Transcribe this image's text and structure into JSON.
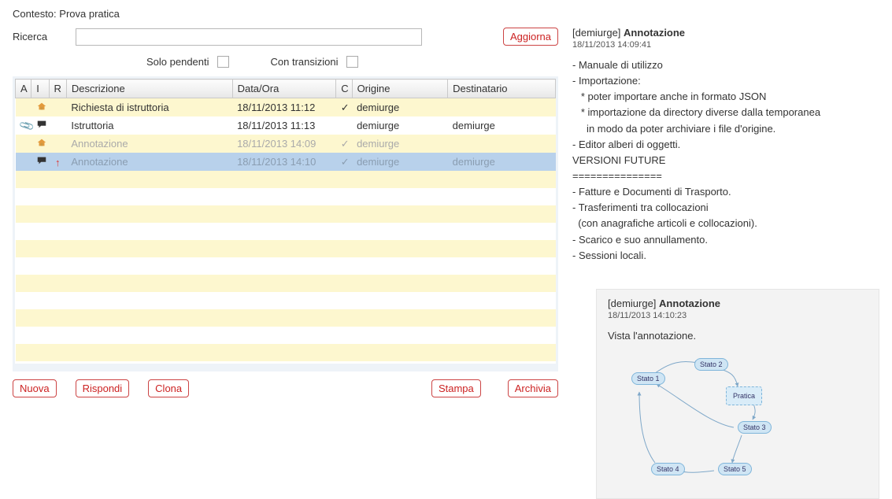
{
  "context": {
    "label": "Contesto:",
    "value": "Prova pratica"
  },
  "search": {
    "label": "Ricerca",
    "value": ""
  },
  "buttons": {
    "aggiorna": "Aggiorna",
    "nuova": "Nuova",
    "rispondi": "Rispondi",
    "clona": "Clona",
    "stampa": "Stampa",
    "archivia": "Archivia"
  },
  "filters": {
    "solo_pendenti": "Solo pendenti",
    "con_transizioni": "Con transizioni"
  },
  "columns": {
    "a": "A",
    "i": "I",
    "r": "R",
    "descrizione": "Descrizione",
    "data_ora": "Data/Ora",
    "c": "C",
    "origine": "Origine",
    "destinatario": "Destinatario"
  },
  "rows": [
    {
      "i_icon": "home",
      "desc": "Richiesta di istruttoria",
      "dt": "18/11/2013 11:12",
      "c": "✓",
      "orig": "demiurge",
      "dest": "",
      "stripe": true
    },
    {
      "a_icon": "clip",
      "i_icon": "chat",
      "desc": "Istruttoria",
      "dt": "18/11/2013 11:13",
      "c": "",
      "orig": "demiurge",
      "dest": "demiurge",
      "stripe": false
    },
    {
      "i_icon": "home",
      "desc": "Annotazione",
      "dt": "18/11/2013 14:09",
      "c": "✓",
      "orig": "demiurge",
      "dest": "",
      "stripe": true,
      "muted": true
    },
    {
      "r_icon": "up",
      "i_icon": "chat",
      "desc": "Annotazione",
      "dt": "18/11/2013 14:10",
      "c": "✓",
      "orig": "demiurge",
      "dest": "demiurge",
      "stripe": false,
      "selected": true,
      "muted": true
    }
  ],
  "ann1": {
    "user": "[demiurge]",
    "title": "Annotazione",
    "time": "18/11/2013 14:09:41",
    "lines": [
      "- Manuale di utilizzo",
      "- Importazione:",
      "   * poter importare anche in formato JSON",
      "   * importazione da directory diverse dalla temporanea",
      "     in modo da poter archiviare i file d'origine.",
      "- Editor alberi di oggetti.",
      "VERSIONI FUTURE",
      "===============",
      "- Fatture e Documenti di Trasporto.",
      "- Trasferimenti tra collocazioni",
      "  (con anagrafiche articoli e collocazioni).",
      "- Scarico e suo annullamento.",
      "- Sessioni locali."
    ]
  },
  "ann2": {
    "user": "[demiurge]",
    "title": "Annotazione",
    "time": "18/11/2013 14:10:23",
    "body": "Vista l'annotazione."
  },
  "diagram": {
    "nodes": {
      "stato1": "Stato 1",
      "stato2": "Stato 2",
      "stato3": "Stato 3",
      "stato4": "Stato 4",
      "stato5": "Stato 5",
      "pratica": "Pratica"
    }
  }
}
